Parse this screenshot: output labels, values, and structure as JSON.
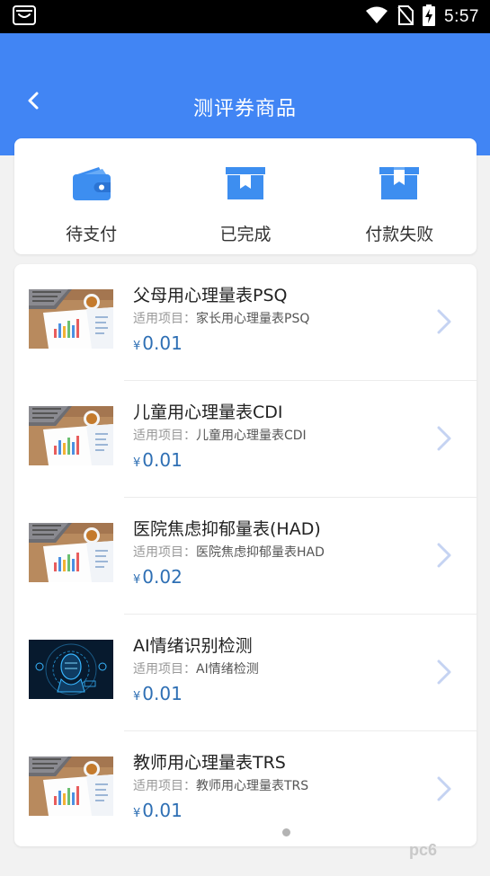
{
  "status_bar": {
    "time": "5:57"
  },
  "header": {
    "title": "测评券商品",
    "background": "#4185f4"
  },
  "order_status_tabs": [
    {
      "label": "待支付",
      "icon": "wallet-icon"
    },
    {
      "label": "已完成",
      "icon": "box-done-icon"
    },
    {
      "label": "付款失败",
      "icon": "box-failed-icon"
    }
  ],
  "products": {
    "applicable_label": "适用项目：",
    "currency": "¥",
    "items": [
      {
        "title": "父母用心理量表PSQ",
        "applicable": "家长用心理量表PSQ",
        "price": "0.01",
        "thumb": "desk-report-image"
      },
      {
        "title": "儿童用心理量表CDI",
        "applicable": "儿童用心理量表CDI",
        "price": "0.01",
        "thumb": "desk-report-image"
      },
      {
        "title": "医院焦虑抑郁量表(HAD)",
        "applicable": "医院焦虑抑郁量表HAD",
        "price": "0.02",
        "thumb": "desk-report-image"
      },
      {
        "title": "AI情绪识别检测",
        "applicable": "AI情绪检测",
        "price": "0.01",
        "thumb": "ai-face-image"
      },
      {
        "title": "教师用心理量表TRS",
        "applicable": "教师用心理量表TRS",
        "price": "0.01",
        "thumb": "desk-report-image"
      }
    ]
  },
  "colors": {
    "accent": "#4185f4",
    "price": "#2e6fb4",
    "icon": "#3d8ef0"
  }
}
